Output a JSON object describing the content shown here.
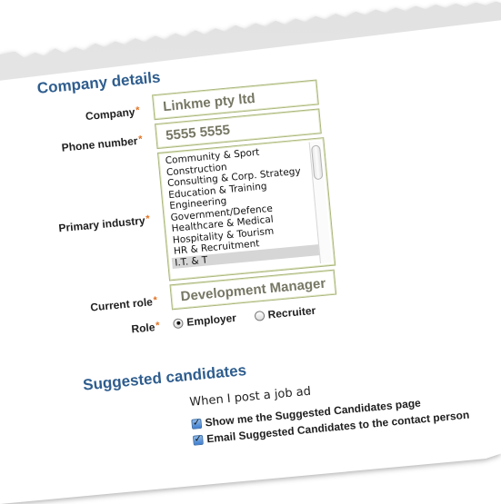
{
  "company_details": {
    "title": "Company details",
    "company": {
      "label": "Company",
      "required": "*",
      "value": "Linkme pty ltd"
    },
    "phone": {
      "label": "Phone number",
      "required": "*",
      "value": "5555 5555"
    },
    "industry": {
      "label": "Primary industry",
      "required": "*",
      "options": [
        "Community & Sport",
        "Construction",
        "Consulting & Corp. Strategy",
        "Education & Training",
        "Engineering",
        "Government/Defence",
        "Healthcare & Medical",
        "Hospitality & Tourism",
        "HR & Recruitment",
        "I.T. & T"
      ],
      "selected": "I.T. & T"
    },
    "current_role": {
      "label": "Current role",
      "required": "*",
      "value": "Development Manager"
    },
    "role": {
      "label": "Role",
      "required": "*",
      "options": [
        "Employer",
        "Recruiter"
      ],
      "selected": "Employer"
    }
  },
  "suggested_candidates": {
    "title": "Suggested candidates",
    "intro": "When I post a job ad",
    "show_me": {
      "label": "Show me the Suggested Candidates page",
      "checked": true
    },
    "email": {
      "label": "Email Suggested Candidates to the contact person",
      "checked": true
    }
  }
}
